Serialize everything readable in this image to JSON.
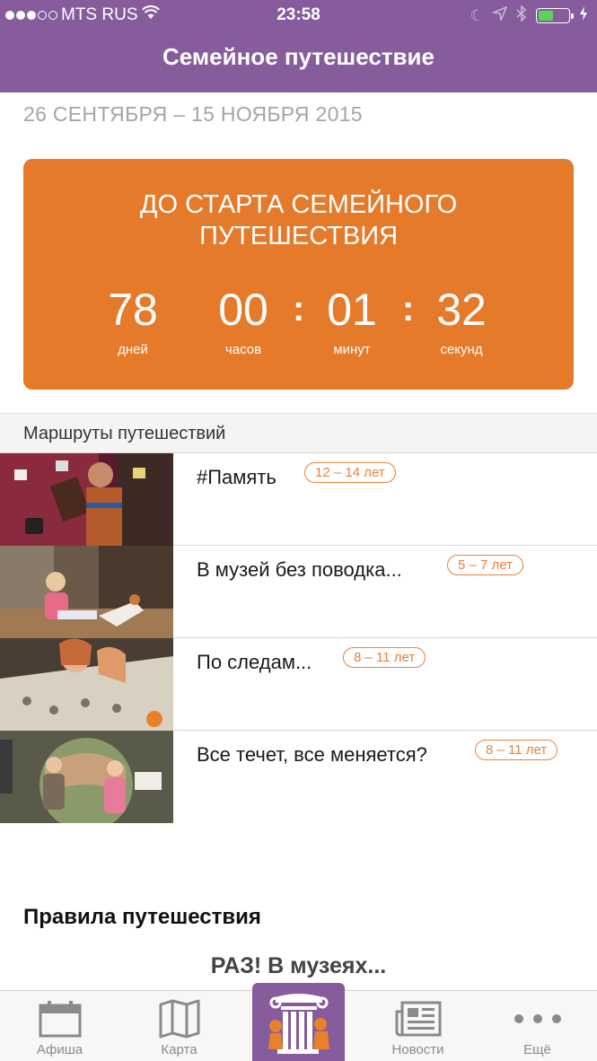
{
  "status_bar": {
    "carrier": "MTS RUS",
    "time": "23:58",
    "signal_dots_filled": 3,
    "signal_dots_total": 5,
    "battery_level": 0.5
  },
  "header": {
    "title": "Семейное путешествие"
  },
  "dates": "26 СЕНТЯБРЯ – 15 НОЯБРЯ 2015",
  "countdown": {
    "title_line1": "ДО СТАРТА СЕМЕЙНОГО",
    "title_line2": "ПУТЕШЕСТВИЯ",
    "days": "78",
    "days_label": "дней",
    "hours": "00",
    "hours_label": "часов",
    "minutes": "01",
    "minutes_label": "минут",
    "seconds": "32",
    "seconds_label": "секунд",
    "separator": ":",
    "color": "#e67a2b"
  },
  "routes_section": {
    "title": "Маршруты путешествий",
    "items": [
      {
        "name": "#Память",
        "age": "12 – 14 лет"
      },
      {
        "name": "В музей без поводка...",
        "age": "5 – 7 лет"
      },
      {
        "name": "По следам...",
        "age": "8 – 11 лет"
      },
      {
        "name": "Все течет, все меняется?",
        "age": "8 – 11 лет"
      }
    ]
  },
  "rules": {
    "title": "Правила путешествия",
    "subtitle": "РАЗ! В музеях..."
  },
  "tabbar": {
    "tabs": [
      {
        "label": "Афиша",
        "icon": "calendar-icon"
      },
      {
        "label": "Карта",
        "icon": "map-icon"
      },
      {
        "label": "",
        "icon": "museum-column-icon"
      },
      {
        "label": "Новости",
        "icon": "newspaper-icon"
      },
      {
        "label": "Ещё",
        "icon": "more-dots-icon"
      }
    ]
  },
  "colors": {
    "header": "#865c9c",
    "accent": "#e67a2b",
    "badge": "#e8823c"
  }
}
